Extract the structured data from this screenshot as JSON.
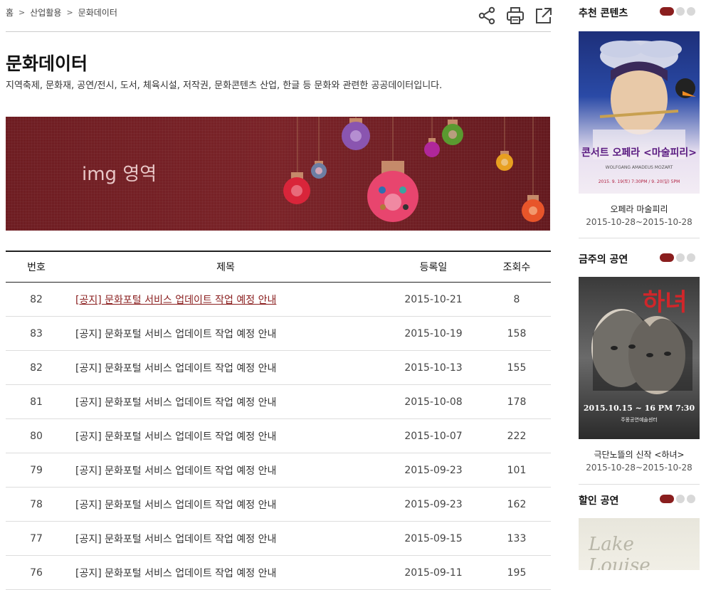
{
  "breadcrumb": [
    "홈",
    "산업활용",
    "문화데이터"
  ],
  "breadcrumb_sep": ">",
  "page": {
    "title": "문화데이터",
    "description": "지역축제, 문화재, 공연/전시, 도서, 체육시설, 저작권, 문화콘텐츠 산업, 한글 등 문화와 관련한 공공데이터입니다."
  },
  "banner": {
    "placeholder": "img 영역"
  },
  "table": {
    "headers": [
      "번호",
      "제목",
      "등록일",
      "조회수"
    ],
    "rows": [
      {
        "no": "82",
        "title": "[공지] 문화포털 서비스 업데이트 작업 예정 안내",
        "date": "2015-10-21",
        "views": "8"
      },
      {
        "no": "83",
        "title": "[공지] 문화포털 서비스 업데이트 작업 예정 안내",
        "date": "2015-10-19",
        "views": "158"
      },
      {
        "no": "82",
        "title": "[공지] 문화포털 서비스 업데이트 작업 예정 안내",
        "date": "2015-10-13",
        "views": "155"
      },
      {
        "no": "81",
        "title": "[공지] 문화포털 서비스 업데이트 작업 예정 안내",
        "date": "2015-10-08",
        "views": "178"
      },
      {
        "no": "80",
        "title": "[공지] 문화포털 서비스 업데이트 작업 예정 안내",
        "date": "2015-10-07",
        "views": "222"
      },
      {
        "no": "79",
        "title": "[공지] 문화포털 서비스 업데이트 작업 예정 안내",
        "date": "2015-09-23",
        "views": "101"
      },
      {
        "no": "78",
        "title": "[공지] 문화포털 서비스 업데이트 작업 예정 안내",
        "date": "2015-09-23",
        "views": "162"
      },
      {
        "no": "77",
        "title": "[공지] 문화포털 서비스 업데이트 작업 예정 안내",
        "date": "2015-09-15",
        "views": "133"
      },
      {
        "no": "76",
        "title": "[공지] 문화포털 서비스 업데이트 작업 예정 안내",
        "date": "2015-09-11",
        "views": "195"
      }
    ]
  },
  "sidebar": {
    "sections": [
      {
        "title": "추천 콘텐츠",
        "caption": "오페라 마술피리",
        "date": "2015-10-28~2015-10-28",
        "poster_text": "콘서트 오페라 <마술피리>",
        "poster_sub": "WOLFGANG AMADEUS MOZART",
        "poster_date": "2015. 9. 19(토) 7:30PM / 9. 20(일) 5PM"
      },
      {
        "title": "금주의 공연",
        "caption": "극단노뜰의 신작 <하녀>",
        "date": "2015-10-28~2015-10-28",
        "poster_text": "하녀",
        "poster_date": "2015.10.15 ~ 16 PM 7:30",
        "poster_venue": "주몽공연예술센터"
      },
      {
        "title": "할인 공연",
        "poster_text": "Lake Louise"
      }
    ]
  },
  "colors": {
    "accent": "#8a1e1e"
  }
}
